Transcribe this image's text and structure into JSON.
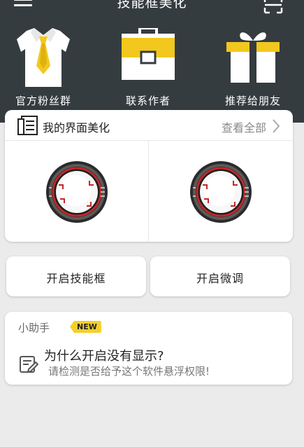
{
  "header": {
    "title": "技能框美化",
    "menu_icon": "menu-icon",
    "scan_icon": "scan-icon",
    "background_color": "#353c40",
    "accent_color": "#f4cf2c"
  },
  "quick_actions": [
    {
      "label": "官方粉丝群",
      "icon": "shirt-tie-icon"
    },
    {
      "label": "联系作者",
      "icon": "briefcase-icon"
    },
    {
      "label": "推荐给朋友",
      "icon": "gift-icon"
    }
  ],
  "skins": {
    "title": "我的界面美化",
    "view_all": "查看全部",
    "items": [
      {
        "icon": "skill-frame-skin-icon"
      },
      {
        "icon": "skill-frame-skin-icon"
      }
    ]
  },
  "actions": {
    "enable_frame": "开启技能框",
    "fine_tune": "开启微调"
  },
  "helper": {
    "title": "小助手",
    "badge": "NEW",
    "question": "为什么开启没有显示?",
    "answer": "请检测是否给予这个软件悬浮权限!"
  }
}
